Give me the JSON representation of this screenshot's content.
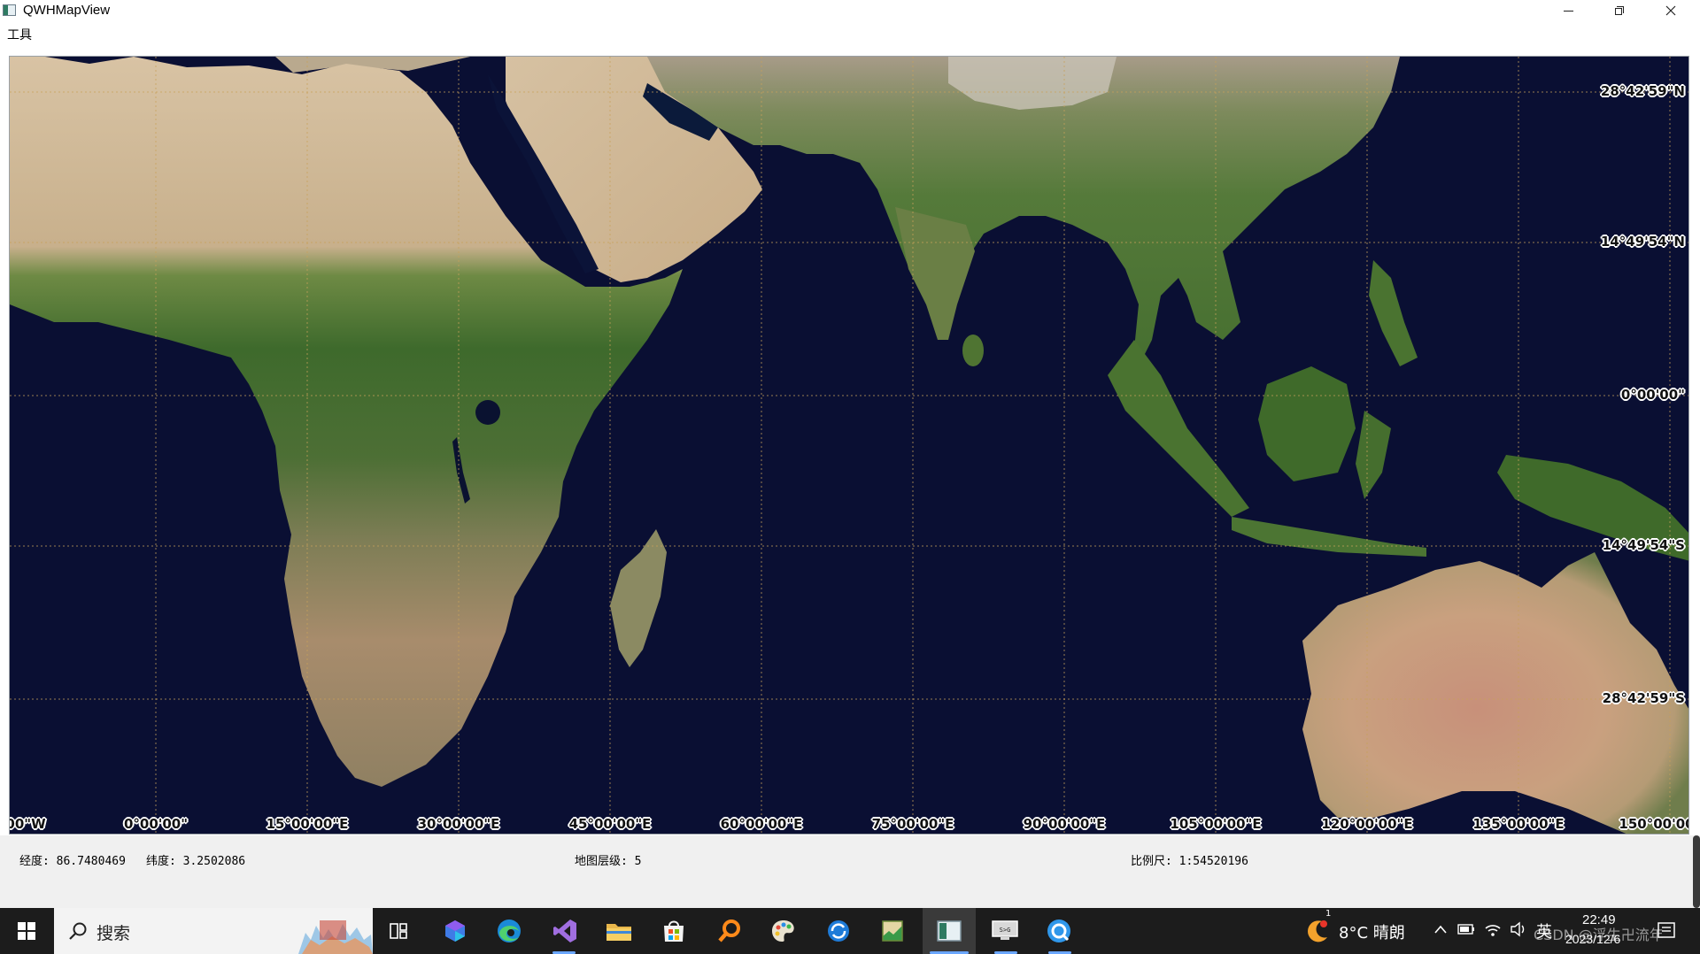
{
  "window": {
    "title": "QWHMapView"
  },
  "menu": {
    "items": [
      "工具"
    ]
  },
  "map": {
    "lat_labels": [
      "28°42'59\"N",
      "14°49'54\"N",
      "0°00'00\"",
      "14°49'54\"S",
      "28°42'59\"S"
    ],
    "lon_labels": [
      "00\"W",
      "0°00'00\"",
      "15°00'00\"E",
      "30°00'00\"E",
      "45°00'00\"E",
      "60°00'00\"E",
      "75°00'00\"E",
      "90°00'00\"E",
      "105°00'00\"E",
      "120°00'00\"E",
      "135°00'00\"E",
      "150°00'00"
    ],
    "colors": {
      "ocean": "#0a0f33",
      "grid": "#c8a15a",
      "desert": "#c9b08f",
      "forest": "#3f6a2a",
      "savanna": "#8a8a5c"
    }
  },
  "status": {
    "longitude": "经度: 86.7480469",
    "latitude": "纬度: 3.2502086",
    "level": "地图层级: 5",
    "scale": "比例尺: 1:54520196"
  },
  "taskbar": {
    "search_label": "搜索",
    "weather": "8°C 晴朗",
    "ime": "英",
    "time": "22:49",
    "date": "2023/12/6",
    "notification_count": "1",
    "watermark": "CSDN @浮生卍流年",
    "apps": [
      "task-view-icon",
      "copilot-icon",
      "edge-icon",
      "visual-studio-icon",
      "file-explorer-icon",
      "microsoft-store-icon",
      "search-tool-icon",
      "paint-icon",
      "sync-icon",
      "map-editor-icon",
      "qwhmapview-icon",
      "remote-desktop-icon",
      "qt-icon"
    ]
  }
}
